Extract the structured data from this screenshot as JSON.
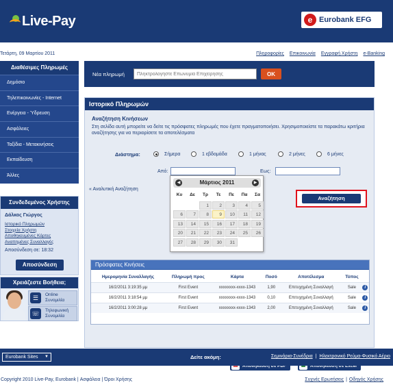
{
  "header": {
    "site_logo": "Live-Pay",
    "bank_logo": "Eurobank EFG"
  },
  "top": {
    "date": "Τετάρτη, 09 Μαρτίου 2011",
    "links": [
      "Πληροφορίες",
      "Επικοινωνία",
      "Εγγραφή Χρήστη",
      "e-Banking"
    ]
  },
  "sidebar": {
    "title": "Διαθέσιμες Πληρωμές",
    "items": [
      {
        "label": "Δημόσιο"
      },
      {
        "label": "Τηλεπικοινωνίες - Internet"
      },
      {
        "label": "Ενέργεια - Ύδρευση"
      },
      {
        "label": "Ασφάλειες"
      },
      {
        "label": "Ταξίδια - Μετακινήσεις"
      },
      {
        "label": "Εκπαίδευση"
      },
      {
        "label": "Άλλες"
      }
    ]
  },
  "user": {
    "title": "Συνδεδεμένος Χρήστης",
    "name": "Δάλκος Γιώργος",
    "links": [
      "Ιστορικό Πληρωμών",
      "Στοιχεία Χρήστη",
      "Αποθηκευμένες Κάρτες",
      "Αναπημένες Συναλλαγές"
    ],
    "logout_time": "Αποσύνδεση σε:  18:32",
    "logout_button": "Αποσύνδεση"
  },
  "help": {
    "title": "Χρειάζεστε Βοήθεια;",
    "options": [
      {
        "line1": "Online",
        "line2": "Συνομιλία",
        "icon": "chat-icon"
      },
      {
        "line1": "Τηλεφωνική",
        "line2": "Συνομιλία",
        "icon": "phone-icon"
      }
    ]
  },
  "new_payment": {
    "label": "Νέα πληρωμή",
    "placeholder": "Πληκτρολογήστε Επωνυμία Επιχείρησης",
    "ok": "OK"
  },
  "history": {
    "title": "Ιστορικό Πληρωμών",
    "search_title": "Αναζήτηση Κινήσεων",
    "description": "Στη σελίδα αυτή μπορείτε να δείτε τις πρόσφατες πληρωμές που έχετε πραγματοποιήσει. Χρησιμοποιείστε τα παρακάτω κριτήρια αναζήτησης για να περιορίσετε τα αποτελέσματα",
    "period_label": "Διάστημα:",
    "periods": [
      {
        "label": "Σήμερα",
        "selected": true
      },
      {
        "label": "1 εβδομάδα",
        "selected": false
      },
      {
        "label": "1 μήνας",
        "selected": false
      },
      {
        "label": "2 μήνες",
        "selected": false
      },
      {
        "label": "6 μήνες",
        "selected": false
      }
    ],
    "from_label": "Από:",
    "to_label": "Εως:",
    "from_value": "",
    "to_value": "",
    "advanced": "« Αναλυτική Αναζήτηση",
    "search_button": "Αναζήτηση"
  },
  "calendar": {
    "title": "Μάρτιος 2011",
    "day_names": [
      "Κυ",
      "Δε",
      "Τρ",
      "Τε",
      "Πε",
      "Πα",
      "Σα"
    ],
    "leading_blanks": 2,
    "days": 31,
    "today": 9
  },
  "recent": {
    "title": "Πρόσφατες Κινήσεις",
    "columns": [
      "Ημερομηνία Συναλλαγής",
      "Πληρωμή προς",
      "Κάρτα",
      "Ποσό",
      "Αποτέλεσμα",
      "Τύπος"
    ],
    "rows": [
      [
        "16/2/2011 3:19:35 μμ",
        "First Event",
        "xxxxxxxx-xxxx-1343",
        "1,90",
        "Επιτυχημένη Συναλλαγή",
        "Sale"
      ],
      [
        "16/2/2011 3:18:54 μμ",
        "First Event",
        "xxxxxxxx-xxxx-1343",
        "0,10",
        "Επιτυχημένη Συναλλαγή",
        "Sale"
      ],
      [
        "16/2/2011 3:00:28 μμ",
        "First Event",
        "xxxxxxxx-xxxx-1343",
        "2,00",
        "Επιτυχημένη Συναλλαγή",
        "Sale"
      ]
    ],
    "export_pdf": "Αποθήκευση σε PDF",
    "export_excel": "Αποθήκευση σε Excel"
  },
  "footer": {
    "sites": "Eurobank Sites",
    "more": "Δείτε ακόμη:",
    "links": [
      "Σεμινάρια-Συνέδρια",
      "Ηλεκτρονικό Ρεύμα-Φυσικό Αέριο"
    ],
    "copyright": "Copyright 2010 Live-Pay, Eurobank | Ασφάλεια | Όροι Χρήσης",
    "bottom_links": [
      "Συχνές Ερωτήσεις",
      "Οδηγός Χρήσης"
    ]
  },
  "colors": {
    "primary": "#1a3a75",
    "accent": "#d9501e",
    "highlight": "#e0111b"
  }
}
